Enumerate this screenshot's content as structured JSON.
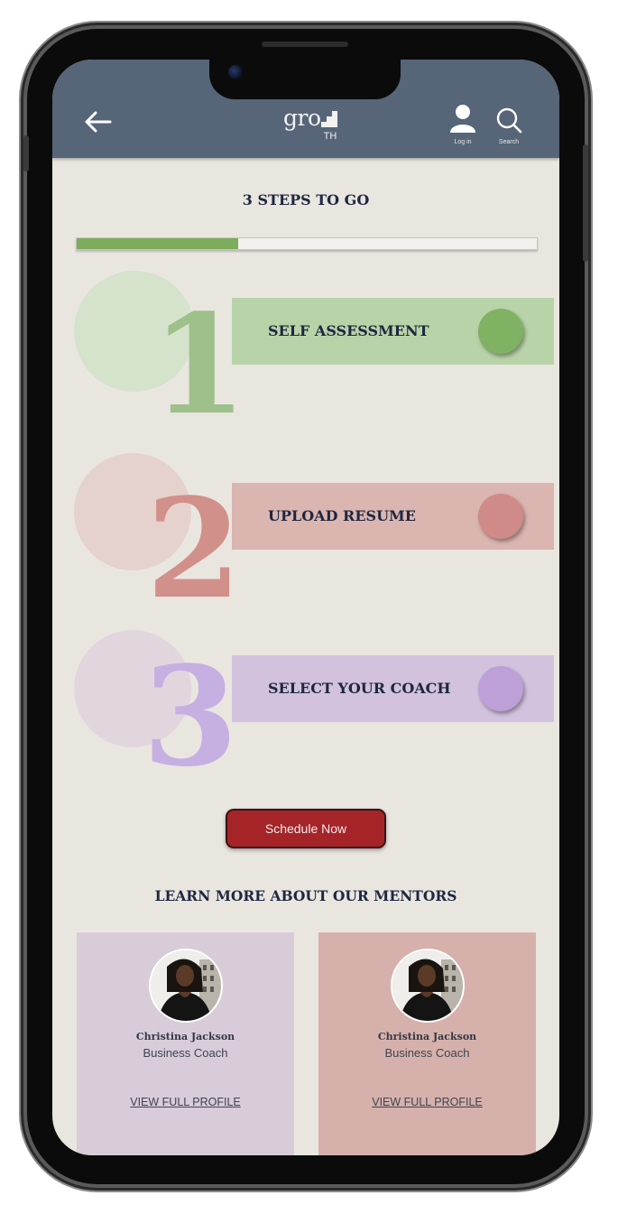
{
  "header": {
    "back_icon": "arrow-left-icon",
    "logo_text": "gro",
    "logo_mark_text": "TH",
    "login_label": "Log in",
    "search_label": "Search",
    "background_color": "#566578"
  },
  "progress": {
    "title": "3 STEPS TO GO",
    "fraction_complete": 0.35,
    "fill_color": "#7cac5c"
  },
  "steps": [
    {
      "number": "1",
      "label": "SELF ASSESSMENT",
      "bar_color": "#b9d3a8",
      "knob_color": "#7fb262",
      "circle_color": "#d5e2cc",
      "number_color": "#9ec08a"
    },
    {
      "number": "2",
      "label": "UPLOAD RESUME",
      "bar_color": "#dbb5b0",
      "knob_color": "#d08a87",
      "circle_color": "#e5d2cc",
      "number_color": "#d2908a"
    },
    {
      "number": "3",
      "label": "SELECT YOUR COACH",
      "bar_color": "#d2c2de",
      "knob_color": "#bda0d8",
      "circle_color": "#e2d6de",
      "number_color": "#c6b0e2"
    }
  ],
  "schedule_button": {
    "label": "Schedule Now",
    "color": "#a52428"
  },
  "mentors": {
    "title": "LEARN MORE ABOUT OUR MENTORS",
    "cards": [
      {
        "name": "Christina Jackson",
        "role": "Business Coach",
        "link": "VIEW FULL PROFILE",
        "card_color": "#d8ccd9"
      },
      {
        "name": "Christina Jackson",
        "role": "Business Coach",
        "link": "VIEW FULL PROFILE",
        "card_color": "#d6b1ac"
      }
    ]
  }
}
